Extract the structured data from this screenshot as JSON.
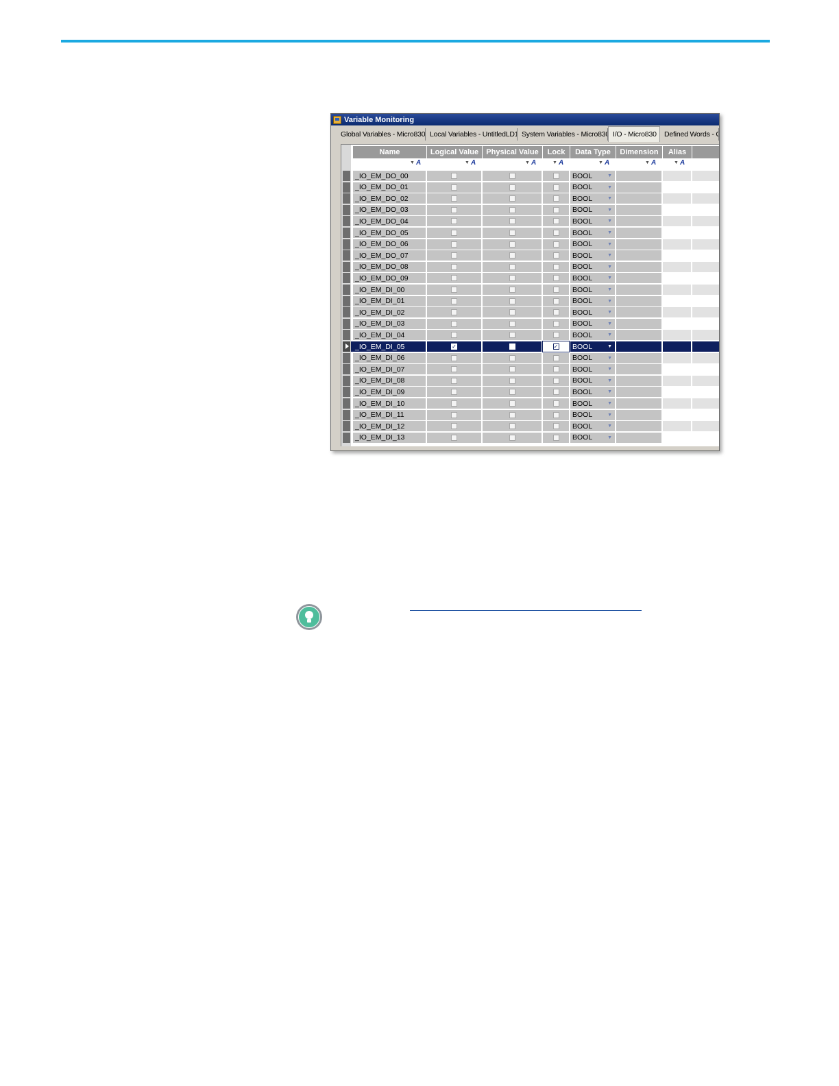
{
  "window": {
    "title": "Variable Monitoring"
  },
  "tabs": [
    {
      "label": "Global Variables - Micro830",
      "active": false
    },
    {
      "label": "Local Variables - UntitledLD1",
      "active": false
    },
    {
      "label": "System Variables - Micro830",
      "active": false
    },
    {
      "label": "I/O - Micro830",
      "active": true
    },
    {
      "label": "Defined Words - C",
      "active": false
    }
  ],
  "columns": [
    "Name",
    "Logical Value",
    "Physical Value",
    "Lock",
    "Data Type",
    "Dimension",
    "Alias"
  ],
  "filter_sort_glyph": "A",
  "rows": [
    {
      "name": "_IO_EM_DO_00",
      "type": "BOOL",
      "logical": false,
      "physical": false,
      "lock": false
    },
    {
      "name": "_IO_EM_DO_01",
      "type": "BOOL",
      "logical": false,
      "physical": false,
      "lock": false
    },
    {
      "name": "_IO_EM_DO_02",
      "type": "BOOL",
      "logical": false,
      "physical": false,
      "lock": false
    },
    {
      "name": "_IO_EM_DO_03",
      "type": "BOOL",
      "logical": false,
      "physical": false,
      "lock": false
    },
    {
      "name": "_IO_EM_DO_04",
      "type": "BOOL",
      "logical": false,
      "physical": false,
      "lock": false
    },
    {
      "name": "_IO_EM_DO_05",
      "type": "BOOL",
      "logical": false,
      "physical": false,
      "lock": false
    },
    {
      "name": "_IO_EM_DO_06",
      "type": "BOOL",
      "logical": false,
      "physical": false,
      "lock": false
    },
    {
      "name": "_IO_EM_DO_07",
      "type": "BOOL",
      "logical": false,
      "physical": false,
      "lock": false
    },
    {
      "name": "_IO_EM_DO_08",
      "type": "BOOL",
      "logical": false,
      "physical": false,
      "lock": false
    },
    {
      "name": "_IO_EM_DO_09",
      "type": "BOOL",
      "logical": false,
      "physical": false,
      "lock": false
    },
    {
      "name": "_IO_EM_DI_00",
      "type": "BOOL",
      "logical": false,
      "physical": false,
      "lock": false
    },
    {
      "name": "_IO_EM_DI_01",
      "type": "BOOL",
      "logical": false,
      "physical": false,
      "lock": false
    },
    {
      "name": "_IO_EM_DI_02",
      "type": "BOOL",
      "logical": false,
      "physical": false,
      "lock": false
    },
    {
      "name": "_IO_EM_DI_03",
      "type": "BOOL",
      "logical": false,
      "physical": false,
      "lock": false
    },
    {
      "name": "_IO_EM_DI_04",
      "type": "BOOL",
      "logical": false,
      "physical": false,
      "lock": false
    },
    {
      "name": "_IO_EM_DI_05",
      "type": "BOOL",
      "logical": true,
      "physical": false,
      "lock": true,
      "selected": true
    },
    {
      "name": "_IO_EM_DI_06",
      "type": "BOOL",
      "logical": false,
      "physical": false,
      "lock": false
    },
    {
      "name": "_IO_EM_DI_07",
      "type": "BOOL",
      "logical": false,
      "physical": false,
      "lock": false
    },
    {
      "name": "_IO_EM_DI_08",
      "type": "BOOL",
      "logical": false,
      "physical": false,
      "lock": false
    },
    {
      "name": "_IO_EM_DI_09",
      "type": "BOOL",
      "logical": false,
      "physical": false,
      "lock": false
    },
    {
      "name": "_IO_EM_DI_10",
      "type": "BOOL",
      "logical": false,
      "physical": false,
      "lock": false
    },
    {
      "name": "_IO_EM_DI_11",
      "type": "BOOL",
      "logical": false,
      "physical": false,
      "lock": false
    },
    {
      "name": "_IO_EM_DI_12",
      "type": "BOOL",
      "logical": false,
      "physical": false,
      "lock": false
    },
    {
      "name": "_IO_EM_DI_13",
      "type": "BOOL",
      "logical": false,
      "physical": false,
      "lock": false
    }
  ],
  "colors": {
    "accent_rule": "#1ba9e1",
    "selection": "#0e1f5e",
    "tip_icon": "#4fbd9c"
  },
  "icons": {
    "app": "app-window-icon",
    "tip": "lightbulb-icon",
    "dropdown": "chevron-down-icon"
  }
}
